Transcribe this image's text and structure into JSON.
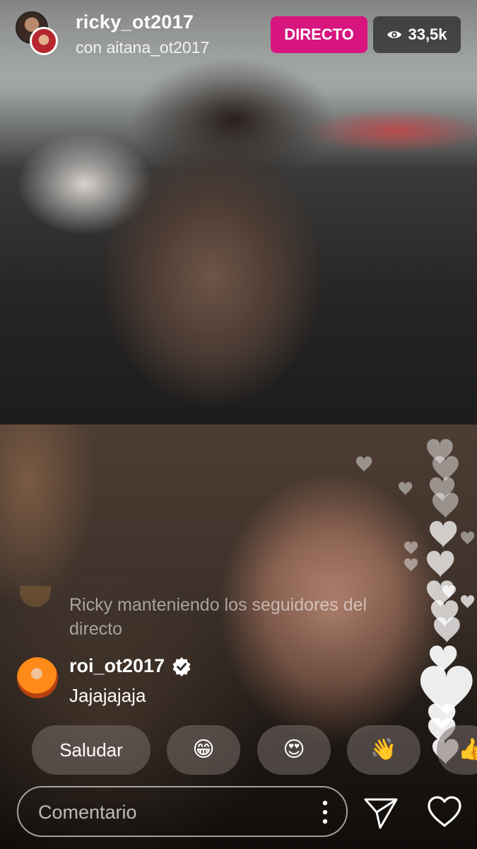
{
  "header": {
    "host_username": "ricky_ot2017",
    "guest_line": "con aitana_ot2017",
    "live_label": "DIRECTO",
    "viewer_count": "33,5k"
  },
  "comments": {
    "faded": {
      "text": "Ricky manteniendo los seguidores del directo"
    },
    "latest": {
      "username": "roi_ot2017",
      "text": "Jajajajaja"
    }
  },
  "quick_reactions": {
    "saludar": "Saludar",
    "grin": "😁",
    "heart_eyes": "😍",
    "wave": "👋",
    "thumbs_up": "👍"
  },
  "composer": {
    "placeholder": "Comentario"
  },
  "colors": {
    "live_badge": "#d8157f",
    "verified": "#ffffff"
  },
  "icons": [
    "eye-icon",
    "verified-icon",
    "more-icon",
    "send-icon",
    "heart-icon"
  ]
}
